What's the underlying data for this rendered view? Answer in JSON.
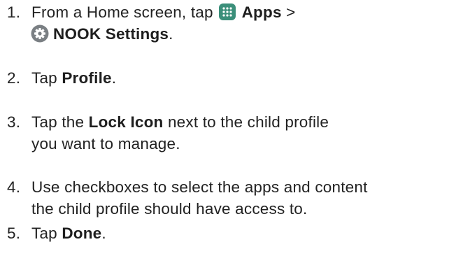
{
  "steps": [
    {
      "number": "1.",
      "line1_pre": "From a Home screen, tap ",
      "apps_label": "Apps",
      "line1_post": " >",
      "settings_label": "NOOK Settings",
      "line2_post": "."
    },
    {
      "number": "2.",
      "pre": "Tap ",
      "bold": "Profile",
      "post": "."
    },
    {
      "number": "3.",
      "line1_pre": "Tap the ",
      "bold": "Lock Icon",
      "line1_post": " next to the child profile",
      "line2": "you want to manage."
    },
    {
      "number": "4.",
      "line1": "Use checkboxes to select the apps and content",
      "line2": "the child profile should have access to."
    },
    {
      "number": "5.",
      "pre": "Tap ",
      "bold": "Done",
      "post": "."
    }
  ],
  "icons": {
    "apps": "apps-grid-icon",
    "settings": "gear-icon"
  },
  "colors": {
    "text": "#222222",
    "apps_icon_bg": "#3b8f7a",
    "settings_icon_bg": "#7a7f83"
  }
}
